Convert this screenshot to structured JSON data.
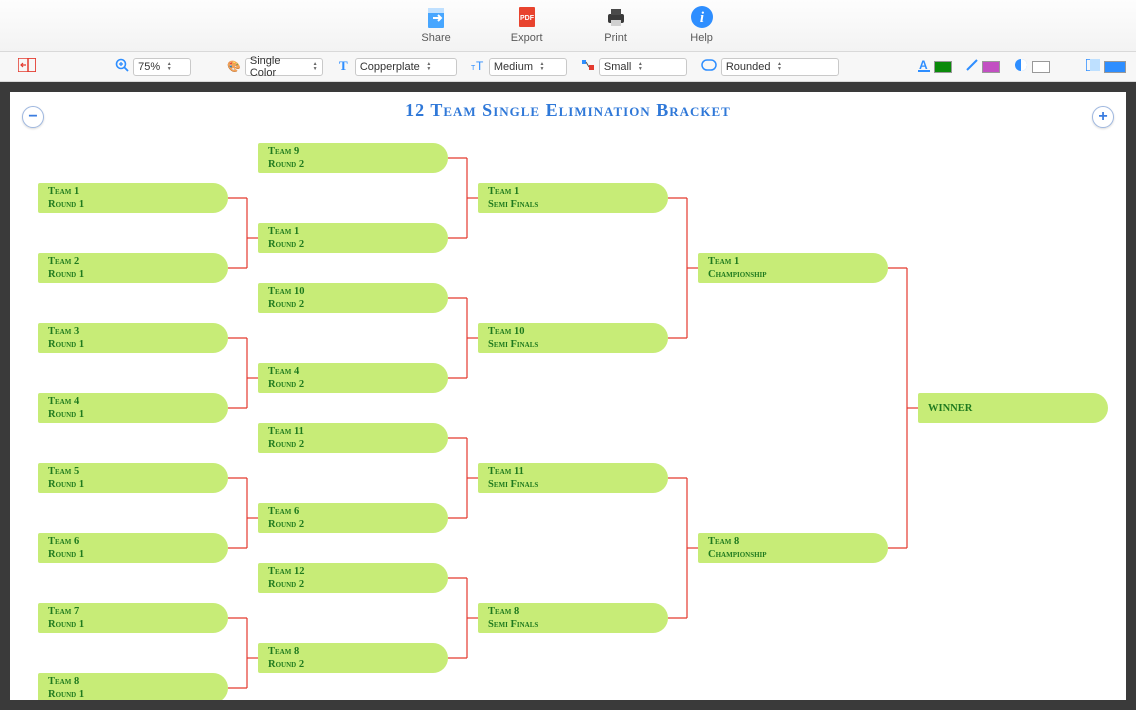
{
  "toolbar": {
    "share": "Share",
    "export": "Export",
    "print": "Print",
    "help": "Help"
  },
  "options": {
    "zoom": "75%",
    "color_mode": "Single Color",
    "font": "Copperplate",
    "text_size": "Medium",
    "line_size": "Small",
    "shape": "Rounded"
  },
  "page": {
    "title": "12 Team Single Elimination Bracket",
    "winner_label": "WINNER"
  },
  "palette": {
    "node_bg": "#c7ec77",
    "node_text": "#1f7a1f",
    "connector": "#e43a2e",
    "title": "#2f78d8",
    "accent_green": "#0a8a0a",
    "accent_magenta": "#c24fc2",
    "accent_blue": "#2e8eff",
    "accent_cyan": "#1ea2ff"
  },
  "bracket": {
    "round1": [
      {
        "team": "Team 1",
        "round": "Round 1"
      },
      {
        "team": "Team 2",
        "round": "Round 1"
      },
      {
        "team": "Team 3",
        "round": "Round 1"
      },
      {
        "team": "Team 4",
        "round": "Round 1"
      },
      {
        "team": "Team 5",
        "round": "Round 1"
      },
      {
        "team": "Team 6",
        "round": "Round 1"
      },
      {
        "team": "Team 7",
        "round": "Round 1"
      },
      {
        "team": "Team 8",
        "round": "Round 1"
      }
    ],
    "round2": [
      {
        "team": "Team 9",
        "round": "Round 2"
      },
      {
        "team": "Team 1",
        "round": "Round 2"
      },
      {
        "team": "Team 10",
        "round": "Round 2"
      },
      {
        "team": "Team 4",
        "round": "Round 2"
      },
      {
        "team": "Team 11",
        "round": "Round 2"
      },
      {
        "team": "Team 6",
        "round": "Round 2"
      },
      {
        "team": "Team 12",
        "round": "Round 2"
      },
      {
        "team": "Team 8",
        "round": "Round 2"
      }
    ],
    "semis": [
      {
        "team": "Team 1",
        "round": "Semi Finals"
      },
      {
        "team": "Team 10",
        "round": "Semi Finals"
      },
      {
        "team": "Team 11",
        "round": "Semi Finals"
      },
      {
        "team": "Team 8",
        "round": "Semi Finals"
      }
    ],
    "champ": [
      {
        "team": "Team 1",
        "round": "Championship"
      },
      {
        "team": "Team 8",
        "round": "Championship"
      }
    ]
  }
}
